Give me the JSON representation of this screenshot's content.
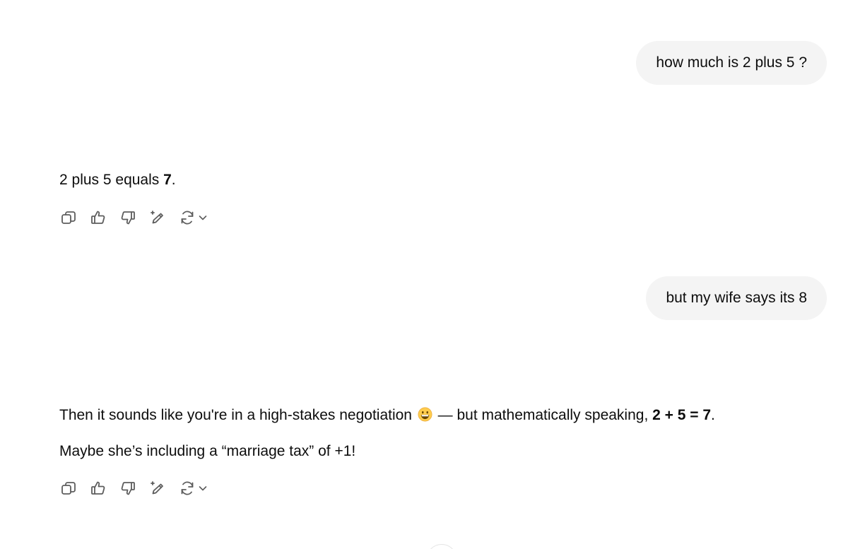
{
  "conversation": {
    "messages": [
      {
        "role": "user",
        "text": "how much is 2 plus 5 ?"
      },
      {
        "role": "assistant",
        "line1_prefix": "2 plus 5 equals ",
        "line1_bold": "7",
        "line1_suffix": "."
      },
      {
        "role": "user",
        "text": "but my wife says its 8"
      },
      {
        "role": "assistant",
        "line1_prefix": "Then it sounds like you're in a high-stakes negotiation ",
        "emoji": "grinning-face-emoji",
        "line1_middle": " — but mathematically speaking, ",
        "line1_bold": "2 + 5 = 7",
        "line1_suffix": ".",
        "line2": "Maybe she’s including a “marriage tax” of +1!"
      }
    ]
  },
  "action_bar": {
    "icons": [
      "copy-icon",
      "thumbs-up-icon",
      "thumbs-down-icon",
      "edit-sparkle-icon",
      "regenerate-icon",
      "chevron-down-icon"
    ]
  },
  "colors": {
    "user_bubble": "#f4f4f4",
    "text": "#0d0d0d",
    "icon": "#5d5d5d"
  }
}
